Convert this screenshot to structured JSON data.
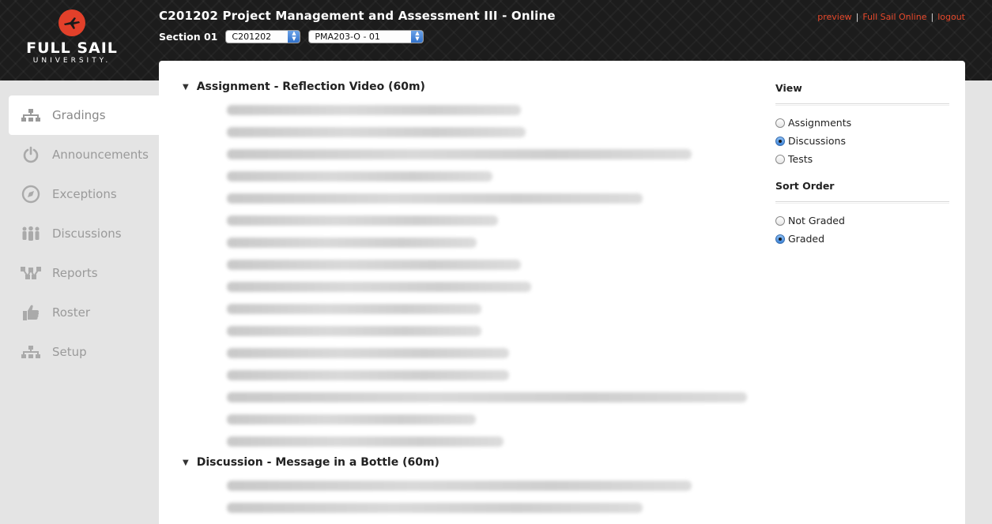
{
  "brand": {
    "name": "FULL SAIL",
    "sub": "UNIVERSITY."
  },
  "header": {
    "course_title": "C201202 Project Management and Assessment III - Online",
    "section_label": "Section 01",
    "course_select": "C201202",
    "section_select": "PMA203-O - 01",
    "links": [
      "preview",
      "Full Sail Online",
      "logout"
    ],
    "accent": "#e8492c"
  },
  "sidebar": {
    "items": [
      {
        "label": "Gradings",
        "icon": "org-chart-icon",
        "active": true
      },
      {
        "label": "Announcements",
        "icon": "power-icon",
        "active": false
      },
      {
        "label": "Exceptions",
        "icon": "compass-icon",
        "active": false
      },
      {
        "label": "Discussions",
        "icon": "people-icon",
        "active": false
      },
      {
        "label": "Reports",
        "icon": "network-icon",
        "active": false
      },
      {
        "label": "Roster",
        "icon": "thumbs-up-icon",
        "active": false
      },
      {
        "label": "Setup",
        "icon": "org-chart-icon",
        "active": false
      }
    ]
  },
  "main": {
    "groups": [
      {
        "title": "Assignment - Reflection Video (60m)",
        "blurred_rows": 16
      },
      {
        "title": "Discussion - Message in a Bottle (60m)",
        "blurred_rows": 2
      }
    ]
  },
  "right_panel": {
    "view_heading": "View",
    "view_options": [
      "Assignments",
      "Discussions",
      "Tests"
    ],
    "view_selected": "Discussions",
    "sort_heading": "Sort Order",
    "sort_options": [
      "Not Graded",
      "Graded"
    ],
    "sort_selected": "Graded"
  }
}
